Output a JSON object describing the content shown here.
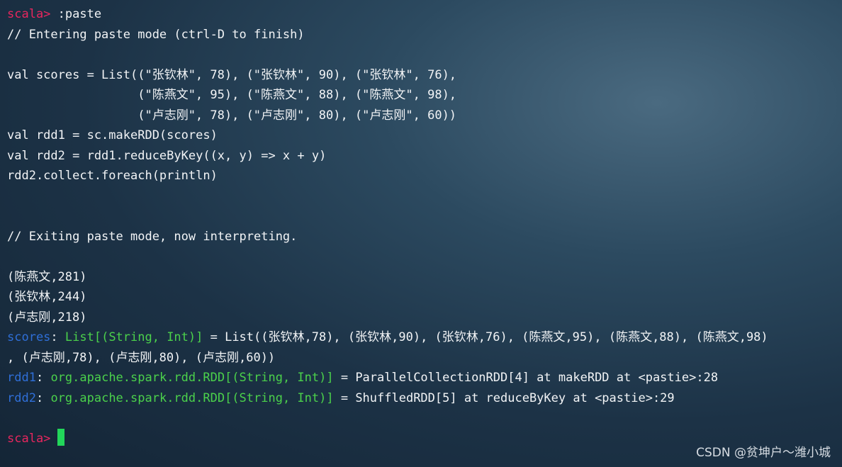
{
  "colors": {
    "prompt": "#e8265e",
    "variable": "#2f6fd8",
    "type": "#4bd14b",
    "cursor": "#22d65a",
    "text": "#f2f4f6"
  },
  "prompt": "scala>",
  "lines": {
    "l1_cmd": " :paste",
    "l2": "// Entering paste mode (ctrl-D to finish)",
    "l3": "",
    "l4": "val scores = List((\"张钦林\", 78), (\"张钦林\", 90), (\"张钦林\", 76),",
    "l5": "                  (\"陈燕文\", 95), (\"陈燕文\", 88), (\"陈燕文\", 98),",
    "l6": "                  (\"卢志刚\", 78), (\"卢志刚\", 80), (\"卢志刚\", 60))",
    "l7": "val rdd1 = sc.makeRDD(scores)",
    "l8": "val rdd2 = rdd1.reduceByKey((x, y) => x + y)",
    "l9": "rdd2.collect.foreach(println)",
    "l10": "",
    "l11": "",
    "l12": "// Exiting paste mode, now interpreting.",
    "l13": "",
    "l14": "(陈燕文,281)",
    "l15": "(张钦林,244)",
    "l16": "(卢志刚,218)",
    "l17_var": "scores",
    "l17_sep": ": ",
    "l17_type": "List[(String, Int)]",
    "l17_rest": " = List((张钦林,78), (张钦林,90), (张钦林,76), (陈燕文,95), (陈燕文,88), (陈燕文,98)",
    "l18": ", (卢志刚,78), (卢志刚,80), (卢志刚,60))",
    "l19_var": "rdd1",
    "l19_sep": ": ",
    "l19_type": "org.apache.spark.rdd.RDD[(String, Int)]",
    "l19_rest": " = ParallelCollectionRDD[4] at makeRDD at <pastie>:28",
    "l20_var": "rdd2",
    "l20_sep": ": ",
    "l20_type": "org.apache.spark.rdd.RDD[(String, Int)]",
    "l20_rest": " = ShuffledRDD[5] at reduceByKey at <pastie>:29",
    "l21": ""
  },
  "watermark": "CSDN @贫坤户～潍小城"
}
